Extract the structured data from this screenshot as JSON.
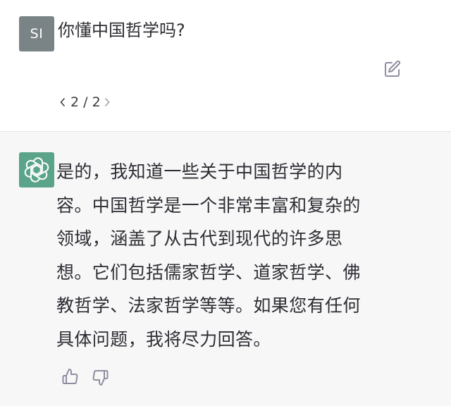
{
  "user": {
    "avatar_initials": "SI",
    "message": "你懂中国哲学吗?",
    "edit_icon": "edit-icon"
  },
  "pager": {
    "text": "2 / 2",
    "prev_icon": "chevron-left-icon",
    "next_icon": "chevron-right-icon"
  },
  "assistant": {
    "avatar_icon": "openai-logo-icon",
    "message_lines": [
      "是的，我知道一些关于中国哲学的内",
      "容。中国哲学是一个非常丰富和复杂的",
      "领域，涵盖了从古代到现代的许多思",
      "想。它们包括儒家哲学、道家哲学、佛",
      "教哲学、法家哲学等等。如果您有任何",
      "具体问题，我将尽力回答。"
    ]
  },
  "feedback": {
    "thumbs_up_icon": "thumbs-up-icon",
    "thumbs_down_icon": "thumbs-down-icon"
  },
  "colors": {
    "user_avatar_bg": "#7a8386",
    "assistant_avatar_bg": "#5aa48a",
    "assistant_bg": "#f7f7f8",
    "text": "#2d2d33"
  }
}
